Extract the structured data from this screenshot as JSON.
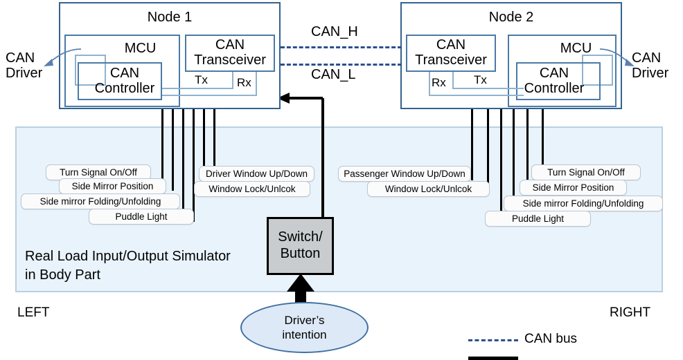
{
  "diagram": {
    "title": "CAN body network with real load input/output simulator"
  },
  "nodes": [
    {
      "id": "node1",
      "title": "Node 1",
      "mcu_label": "MCU",
      "controller_label": "CAN\nController",
      "transceiver_label": "CAN\nTransceiver",
      "tx_label": "Tx",
      "rx_label": "Rx",
      "driver_label": "CAN\nDriver"
    },
    {
      "id": "node2",
      "title": "Node 2",
      "mcu_label": "MCU",
      "controller_label": "CAN\nController",
      "transceiver_label": "CAN\nTransceiver",
      "tx_label": "Tx",
      "rx_label": "Rx",
      "driver_label": "CAN\nDriver"
    }
  ],
  "bus": {
    "can_h_label": "CAN_H",
    "can_l_label": "CAN_L"
  },
  "simulator": {
    "title": "Real Load Input/Output Simulator\nin Body Part"
  },
  "signals_left_group_a": [
    {
      "label": "Turn Signal On/Off"
    },
    {
      "label": "Side Mirror  Position"
    },
    {
      "label": "Side mirror  Folding/Unfolding"
    },
    {
      "label": "Puddle  Light"
    }
  ],
  "signals_left_group_b": [
    {
      "label": "Driver Window Up/Down"
    },
    {
      "label": "Window  Lock/Unlcok"
    }
  ],
  "signals_right_group_a": [
    {
      "label": "Passenger Window Up/Down"
    },
    {
      "label": "Window  Lock/Unlcok"
    }
  ],
  "signals_right_group_b": [
    {
      "label": "Turn Signal On/Off"
    },
    {
      "label": "Side Mirror  Position"
    },
    {
      "label": "Side mirror  Folding/Unfolding"
    },
    {
      "label": "Puddle  Light"
    }
  ],
  "switch": {
    "line1": "Switch/",
    "line2": "Button"
  },
  "driver_intention": {
    "line1": "Driver’s",
    "line2": "intention"
  },
  "orientation": {
    "left": "LEFT",
    "right": "RIGHT"
  },
  "legend": [
    {
      "style": "dashed",
      "label": "CAN bus"
    },
    {
      "style": "solid",
      "label": ""
    }
  ],
  "colors": {
    "node_border": "#33628f",
    "sub_border": "#4a7aa7",
    "driver_border": "#8fb2cf",
    "panel_fill": "#e9f3fb",
    "panel_border": "#b9cfe2",
    "bus_dash": "#2c4f8c",
    "switch_fill": "#c8ccce",
    "ellipse_fill": "#dde9f6",
    "ellipse_border": "#3f6fa0",
    "wire": "#000000"
  }
}
